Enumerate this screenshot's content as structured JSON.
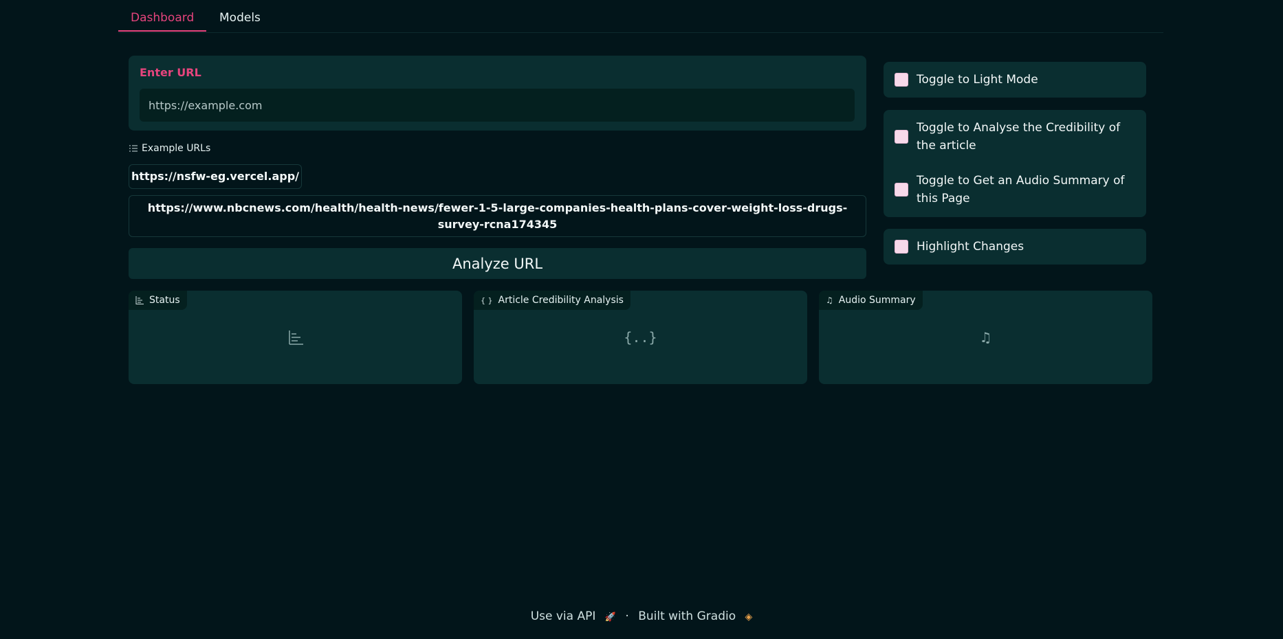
{
  "tabs": [
    {
      "label": "Dashboard",
      "active": true
    },
    {
      "label": "Models",
      "active": false
    }
  ],
  "url_panel": {
    "label": "Enter URL",
    "placeholder": "https://example.com",
    "value": ""
  },
  "examples": {
    "header": "Example URLs",
    "items": [
      "https://nsfw-eg.vercel.app/",
      "https://www.nbcnews.com/health/health-news/fewer-1-5-large-companies-health-plans-cover-weight-loss-drugs-survey-rcna174345"
    ]
  },
  "analyze_button": "Analyze URL",
  "toggles": {
    "light_mode": "Toggle to Light Mode",
    "credibility": "Toggle to Analyse the Credibility of the article",
    "audio": "Toggle to Get an Audio Summary of this Page",
    "highlight": "Highlight Changes"
  },
  "outputs": {
    "status": "Status",
    "credibility": "Article Credibility Analysis",
    "audio": "Audio Summary"
  },
  "footer": {
    "api": "Use via API",
    "separator": "·",
    "built": "Built with Gradio"
  },
  "colors": {
    "accent": "#e6447d",
    "panel": "#0a2e30",
    "background": "#02151a"
  }
}
